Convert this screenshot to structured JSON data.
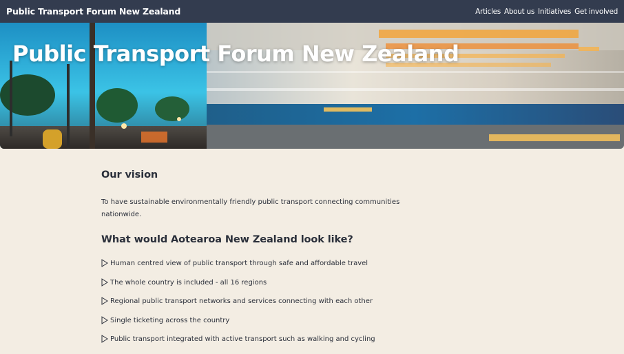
{
  "site": {
    "brand": "Public Transport Forum New Zealand"
  },
  "nav": {
    "items": [
      {
        "label": "Articles",
        "name": "nav-articles"
      },
      {
        "label": "About us",
        "name": "nav-about-us"
      },
      {
        "label": "Initiatives",
        "name": "nav-initiatives"
      },
      {
        "label": "Get involved",
        "name": "nav-get-involved"
      }
    ]
  },
  "hero": {
    "title": "Public Transport Forum New Zealand"
  },
  "vision": {
    "heading": "Our vision",
    "text": "To have sustainable environmentally friendly public transport connecting communities nationwide."
  },
  "look": {
    "heading": "What would Aotearoa New Zealand look like?",
    "bullet_icon": "play-triangle-icon",
    "items": [
      "Human centred view of public transport through safe and affordable travel",
      "The whole country is included - all 16 regions",
      "Regional public transport networks and services connecting with each other",
      "Single ticketing across the country",
      "Public transport integrated with active transport such as walking and cycling"
    ]
  },
  "colors": {
    "topbar": "#333c4f",
    "background": "#f3ede3",
    "text": "#2a2f3a"
  }
}
